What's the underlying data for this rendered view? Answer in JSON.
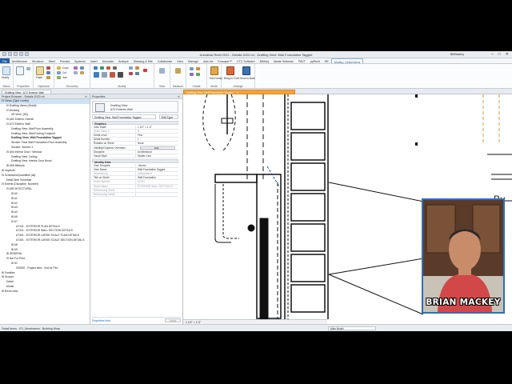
{
  "titlebar": {
    "title": "Autodesk Revit 2022 - Details 2022.rvt - Drafting View: Wall Foundation Tagged",
    "user": "BBMackey",
    "window_controls": [
      "–",
      "□",
      "✕"
    ]
  },
  "ribbon_tabs": [
    "File",
    "Architecture",
    "Structure",
    "Steel",
    "Precast",
    "Systems",
    "Insert",
    "Annotate",
    "Analyze",
    "Massing & Site",
    "Collaborate",
    "View",
    "Manage",
    "Add-Ins",
    "Enscape™",
    "CTC Software",
    "BIMobj",
    "Ideate Software",
    "PAVT",
    "pyRevit",
    "RE",
    "Modify | Detail Items"
  ],
  "active_tab_index": 21,
  "ribbon_groups": [
    {
      "label": "Select",
      "items": [
        "Modify"
      ]
    },
    {
      "label": "Properties",
      "items": []
    },
    {
      "label": "Clipboard",
      "items": [
        "Paste",
        "Cope",
        "Cut",
        "Join"
      ]
    },
    {
      "label": "Geometry",
      "items": []
    },
    {
      "label": "Modify",
      "items": []
    },
    {
      "label": "View",
      "items": []
    },
    {
      "label": "Measure",
      "items": []
    },
    {
      "label": "Create",
      "items": []
    },
    {
      "label": "Mode",
      "items": [
        "Edit Family"
      ]
    },
    {
      "label": "Arrange",
      "items": [
        "Bring to Front",
        "Send to Back"
      ]
    }
  ],
  "view_tabs": {
    "left": {
      "label": "Drafting View : A72 Exterior Wall"
    },
    "current": {
      "label": "Drafting View: Wall Foundation Tagged"
    }
  },
  "project_browser": {
    "title": "Project Browser - Details 2022.rvt",
    "rows": [
      {
        "text": "⊟ Views (Type Levels)",
        "indent": 0,
        "selected": true
      },
      {
        "text": "⊟ Drafting Views (Detail)",
        "indent": 1
      },
      {
        "text": "⊟ Working",
        "indent": 1
      },
      {
        "text": "3D View: {3D}",
        "indent": 2
      },
      {
        "text": "⊟ A51 Exterior Overall",
        "indent": 1
      },
      {
        "text": "⊟ A72 Exterior Wall",
        "indent": 1
      },
      {
        "text": "Drafting View: Wall Floor Assembly",
        "indent": 2
      },
      {
        "text": "Drafting View: Wall Footing Footprint",
        "indent": 2
      },
      {
        "text": "Drafting View: Wall Foundation Tagged",
        "indent": 2,
        "bold": true
      },
      {
        "text": "Section: Real Wall Foundation Floor Assembly",
        "indent": 2
      },
      {
        "text": "Section: Section 1",
        "indent": 2
      },
      {
        "text": "⊟ A54 Interior Door / Window",
        "indent": 1
      },
      {
        "text": "Drafting View: Ceiling",
        "indent": 2
      },
      {
        "text": "Drafting View: Interior Door Wood",
        "indent": 2
      },
      {
        "text": "⊞ A55 Millwork",
        "indent": 1
      },
      {
        "text": "⊞ Legends",
        "indent": 0
      },
      {
        "text": "⊟ Schedules/Quantities (all)",
        "indent": 0
      },
      {
        "text": "Detail Item Schedule",
        "indent": 1
      },
      {
        "text": "⊟ Sheets (Discipline, Number)",
        "indent": 0
      },
      {
        "text": "⊟ ARCHITECTURAL",
        "indent": 1
      },
      {
        "text": "⊞ A0",
        "indent": 2
      },
      {
        "text": "⊞ A1",
        "indent": 2
      },
      {
        "text": "⊞ A2",
        "indent": 2
      },
      {
        "text": "⊞ A3",
        "indent": 2
      },
      {
        "text": "⊞ A4",
        "indent": 2
      },
      {
        "text": "⊞ A5",
        "indent": 2
      },
      {
        "text": "⊟ A7",
        "indent": 2
      },
      {
        "text": "A7101 - EXTERIOR PLAN DETAILS",
        "indent": 3
      },
      {
        "text": "A7201 - EXTERIOR WALL SECTION DETAILS",
        "indent": 3
      },
      {
        "text": "A7301 - EXTERIOR LARGE SCALE PLAN DETAILS",
        "indent": 3
      },
      {
        "text": "A7401 - EXTERIOR LARGE SCALE SECTION DETAILS",
        "indent": 3
      },
      {
        "text": "⊞ A8",
        "indent": 2
      },
      {
        "text": "⊞ A9",
        "indent": 2
      },
      {
        "text": "⊞ GENERAL",
        "indent": 1
      },
      {
        "text": "⊟ Not For Print",
        "indent": 1
      },
      {
        "text": "⊞ 00",
        "indent": 2
      },
      {
        "text": "000000 - Project Item - Not for Plot",
        "indent": 3
      },
      {
        "text": "⊞ Families",
        "indent": 0
      },
      {
        "text": "⊞ Groups",
        "indent": 0
      },
      {
        "text": "Detail",
        "indent": 1
      },
      {
        "text": "Model",
        "indent": 1
      },
      {
        "text": "⊞ Revit Links",
        "indent": 0
      }
    ]
  },
  "properties": {
    "title": "Properties",
    "type_line1": "Drafting View",
    "type_line2": "A72 Exterior Wall",
    "selector": "Drafting View: Wall Foundation Tagged",
    "edit_type": "Edit Type",
    "sections": [
      {
        "label": "Graphics",
        "rows": [
          {
            "k": "View Scale",
            "v": "1 1/2\" = 1'-0\""
          },
          {
            "k": "Scale Value    1:",
            "v": "8",
            "grey": true
          },
          {
            "k": "Detail Level",
            "v": "Fine"
          },
          {
            "k": "Detail Number",
            "v": "1"
          },
          {
            "k": "Rotation on Sheet",
            "v": "None"
          },
          {
            "k": "Visibility/Graphics Overrides",
            "v": "",
            "button": "Edit..."
          },
          {
            "k": "Discipline",
            "v": "Architectural"
          },
          {
            "k": "Visual Style",
            "v": "Hidden Line"
          }
        ]
      },
      {
        "label": "Identity Data",
        "rows": [
          {
            "k": "View Template",
            "v": "<None>"
          },
          {
            "k": "View Name",
            "v": "Wall Foundation Tagged"
          },
          {
            "k": "Dependency",
            "v": "Independent",
            "grey": true
          },
          {
            "k": "Title on Sheet",
            "v": "Wall Foundation"
          },
          {
            "k": "Sheet Number",
            "v": "A7201",
            "grey": true
          },
          {
            "k": "Sheet Name",
            "v": "EXTERIOR WALL SECTION D...",
            "grey": true
          },
          {
            "k": "Referencing Sheet",
            "v": "",
            "grey": true
          },
          {
            "k": "Referencing Detail",
            "v": "",
            "grey": true
          }
        ]
      }
    ],
    "help_link": "Properties help",
    "apply": "Apply"
  },
  "canvas_text": "Bu",
  "view_control_bar": "1 1/2\" = 1'-0\"",
  "statusbar": {
    "text": "Detail Items : 07I_Membranes : Building Wrap",
    "model": "Main Model"
  },
  "webcam": {
    "name": "BRIAN MACKEY"
  },
  "colors": {
    "file_tab": "#1f5fa8",
    "current_view_tab": "#f2a33a",
    "webcam_border": "#2a6fc0",
    "selection": "#cfe3f7"
  }
}
